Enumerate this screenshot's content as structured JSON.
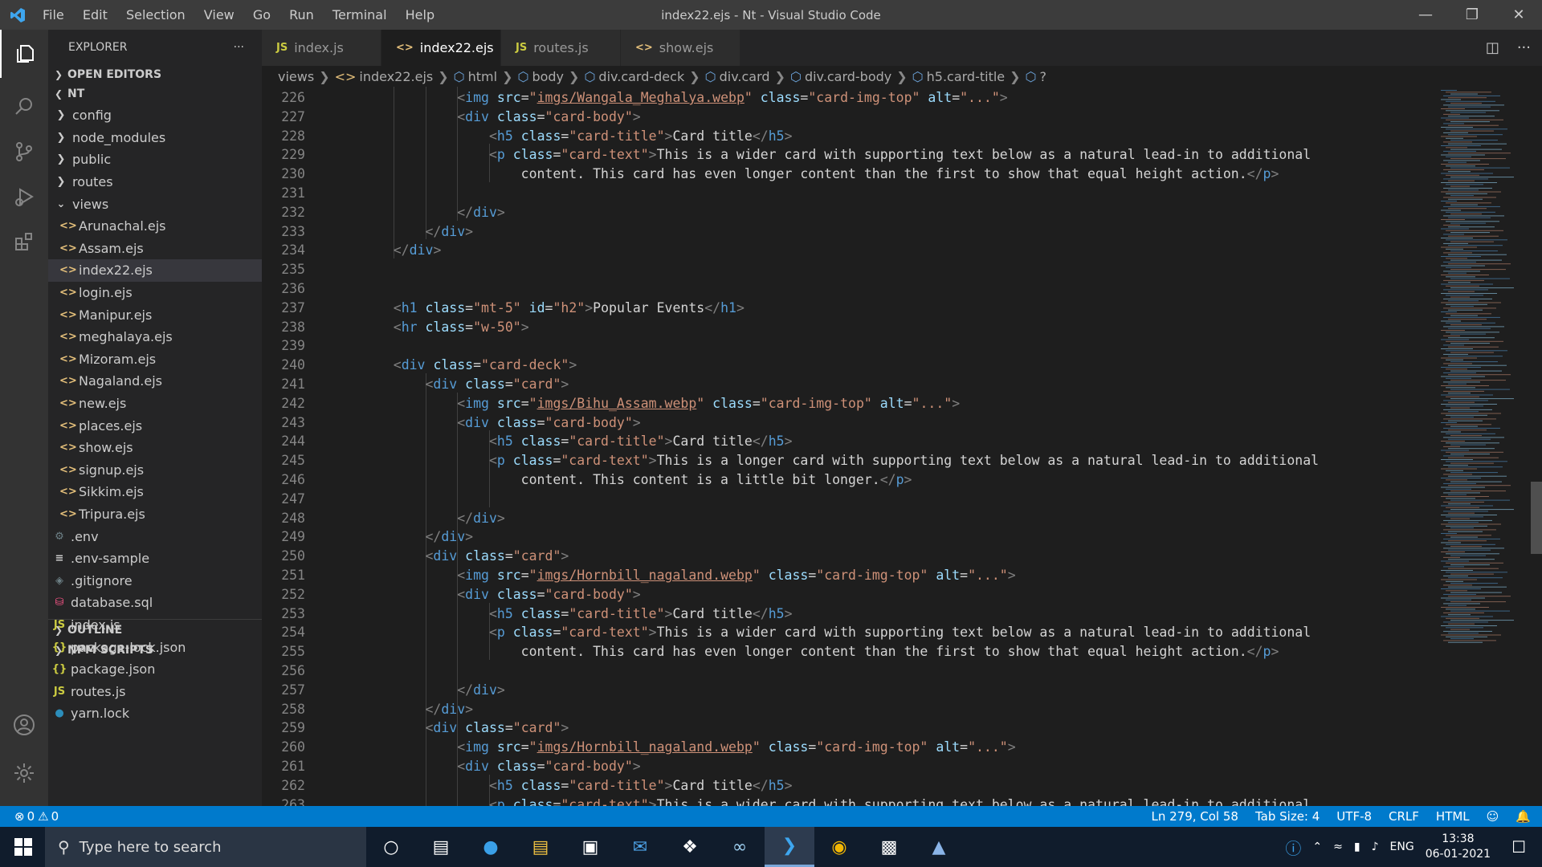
{
  "window": {
    "title": "index22.ejs - Nt - Visual Studio Code",
    "menu": [
      "File",
      "Edit",
      "Selection",
      "View",
      "Go",
      "Run",
      "Terminal",
      "Help"
    ]
  },
  "explorer": {
    "header": "EXPLORER",
    "open_editors": "OPEN EDITORS",
    "root": "NT",
    "outline": "OUTLINE",
    "npm_scripts": "NPM SCRIPTS",
    "folders": [
      "config",
      "node_modules",
      "public",
      "routes"
    ],
    "views_folder": "views",
    "view_files": [
      "Arunachal.ejs",
      "Assam.ejs",
      "index22.ejs",
      "login.ejs",
      "Manipur.ejs",
      "meghalaya.ejs",
      "Mizoram.ejs",
      "Nagaland.ejs",
      "new.ejs",
      "places.ejs",
      "show.ejs",
      "signup.ejs",
      "Sikkim.ejs",
      "Tripura.ejs"
    ],
    "root_files": [
      {
        "name": ".env",
        "icon": "gear-icon"
      },
      {
        "name": ".env-sample",
        "icon": "lines-icon"
      },
      {
        "name": ".gitignore",
        "icon": "git-icon"
      },
      {
        "name": "database.sql",
        "icon": "database-icon"
      },
      {
        "name": "index.js",
        "icon": "js-icon"
      },
      {
        "name": "package-lock.json",
        "icon": "json-icon"
      },
      {
        "name": "package.json",
        "icon": "json-icon"
      },
      {
        "name": "routes.js",
        "icon": "js-icon"
      },
      {
        "name": "yarn.lock",
        "icon": "yarn-icon"
      }
    ]
  },
  "tabs": [
    {
      "label": "index.js",
      "icon": "JS"
    },
    {
      "label": "index22.ejs",
      "icon": "<>"
    },
    {
      "label": "routes.js",
      "icon": "JS"
    },
    {
      "label": "show.ejs",
      "icon": "<>"
    }
  ],
  "breadcrumb": [
    "views",
    "index22.ejs",
    "html",
    "body",
    "div.card-deck",
    "div.card",
    "div.card-body",
    "h5.card-title",
    "?"
  ],
  "editor": {
    "line_numbers": [
      "226",
      "227",
      "228",
      "229",
      "230",
      "231",
      "232",
      "233",
      "234",
      "235",
      "236",
      "237",
      "238",
      "239",
      "240",
      "241",
      "242",
      "243",
      "244",
      "245",
      "246",
      "247",
      "248",
      "249",
      "250",
      "251",
      "252",
      "253",
      "254",
      "255",
      "256",
      "257",
      "258",
      "259",
      "260",
      "261",
      "262",
      "263"
    ]
  },
  "status": {
    "problems": "0",
    "warnings": "0",
    "position": "Ln 279, Col 58",
    "tab_size": "Tab Size: 4",
    "encoding": "UTF-8",
    "eol": "CRLF",
    "language": "HTML"
  },
  "taskbar": {
    "search_placeholder": "Type here to search",
    "lang": "ENG",
    "time": "13:38",
    "date": "06-01-2021"
  }
}
